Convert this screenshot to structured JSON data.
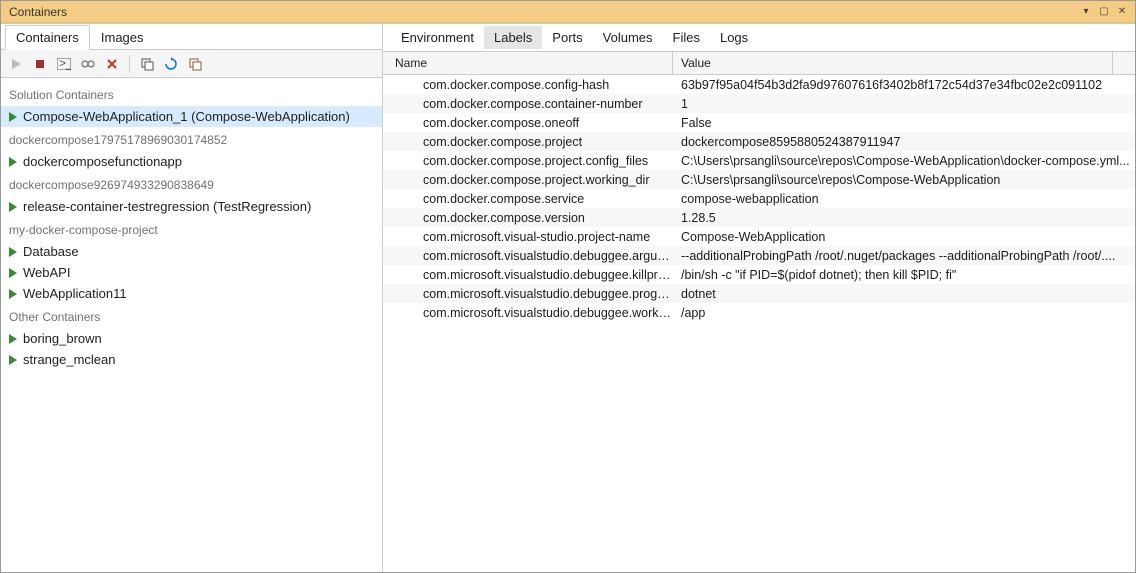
{
  "window": {
    "title": "Containers"
  },
  "leftTabs": [
    {
      "label": "Containers",
      "active": true
    },
    {
      "label": "Images",
      "active": false
    }
  ],
  "tree": {
    "sections": [
      {
        "header": "Solution Containers",
        "items": [
          {
            "label": "Compose-WebApplication_1 (Compose-WebApplication)",
            "selected": true
          }
        ]
      },
      {
        "header": "dockercompose17975178969030174852",
        "items": [
          {
            "label": "dockercomposefunctionapp"
          }
        ]
      },
      {
        "header": "dockercompose926974933290838649",
        "items": [
          {
            "label": "release-container-testregression (TestRegression)"
          }
        ]
      },
      {
        "header": "my-docker-compose-project",
        "items": [
          {
            "label": "Database"
          },
          {
            "label": "WebAPI"
          },
          {
            "label": "WebApplication11"
          }
        ]
      },
      {
        "header": "Other Containers",
        "items": [
          {
            "label": "boring_brown"
          },
          {
            "label": "strange_mclean"
          }
        ]
      }
    ]
  },
  "rightTabs": [
    {
      "label": "Environment",
      "active": false
    },
    {
      "label": "Labels",
      "active": true
    },
    {
      "label": "Ports",
      "active": false
    },
    {
      "label": "Volumes",
      "active": false
    },
    {
      "label": "Files",
      "active": false
    },
    {
      "label": "Logs",
      "active": false
    }
  ],
  "columns": {
    "name": "Name",
    "value": "Value"
  },
  "labels": [
    {
      "name": "com.docker.compose.config-hash",
      "value": "63b97f95a04f54b3d2fa9d97607616f3402b8f172c54d37e34fbc02e2c091102"
    },
    {
      "name": "com.docker.compose.container-number",
      "value": "1"
    },
    {
      "name": "com.docker.compose.oneoff",
      "value": "False"
    },
    {
      "name": "com.docker.compose.project",
      "value": "dockercompose8595880524387911947"
    },
    {
      "name": "com.docker.compose.project.config_files",
      "value": "C:\\Users\\prsangli\\source\\repos\\Compose-WebApplication\\docker-compose.yml..."
    },
    {
      "name": "com.docker.compose.project.working_dir",
      "value": "C:\\Users\\prsangli\\source\\repos\\Compose-WebApplication"
    },
    {
      "name": "com.docker.compose.service",
      "value": "compose-webapplication"
    },
    {
      "name": "com.docker.compose.version",
      "value": "1.28.5"
    },
    {
      "name": "com.microsoft.visual-studio.project-name",
      "value": "Compose-WebApplication"
    },
    {
      "name": "com.microsoft.visualstudio.debuggee.arguments",
      "value": " --additionalProbingPath /root/.nuget/packages --additionalProbingPath /root/...."
    },
    {
      "name": "com.microsoft.visualstudio.debuggee.killprogram",
      "value": "/bin/sh -c \"if PID=$(pidof dotnet); then kill $PID; fi\""
    },
    {
      "name": "com.microsoft.visualstudio.debuggee.program",
      "value": "dotnet"
    },
    {
      "name": "com.microsoft.visualstudio.debuggee.workingdire...",
      "value": "/app"
    }
  ]
}
